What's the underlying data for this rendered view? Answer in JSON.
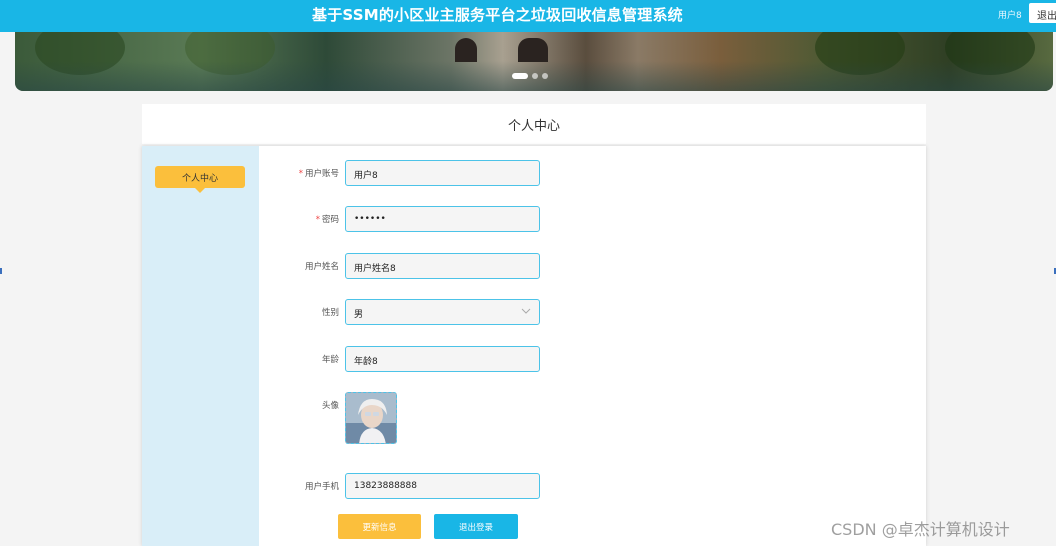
{
  "header": {
    "title": "基于SSM的小区业主服务平台之垃圾回收信息管理系统",
    "user_name": "用户8",
    "logout_label": "退出"
  },
  "banner": {
    "slides": 3,
    "active_slide": 1
  },
  "section": {
    "title": "个人中心"
  },
  "sidebar": {
    "items": [
      {
        "label": "个人中心"
      }
    ]
  },
  "form": {
    "fields": [
      {
        "label": "用户账号",
        "required": true,
        "value": "用户8"
      },
      {
        "label": "密码",
        "required": true,
        "value": "••••••"
      },
      {
        "label": "用户姓名",
        "required": false,
        "value": "用户姓名8"
      },
      {
        "label": "性别",
        "required": false,
        "value": "男"
      },
      {
        "label": "年龄",
        "required": false,
        "value": "年龄8"
      },
      {
        "label": "头像",
        "required": false
      },
      {
        "label": "用户手机",
        "required": false,
        "value": "13823888888"
      }
    ],
    "required_mark": "*"
  },
  "buttons": {
    "update_label": "更新信息",
    "logout_label": "退出登录"
  },
  "watermark": "CSDN @卓杰计算机设计",
  "colors": {
    "primary": "#19b6e6",
    "accent": "#fbbf3c",
    "sidebar_bg": "#d9eef8"
  }
}
